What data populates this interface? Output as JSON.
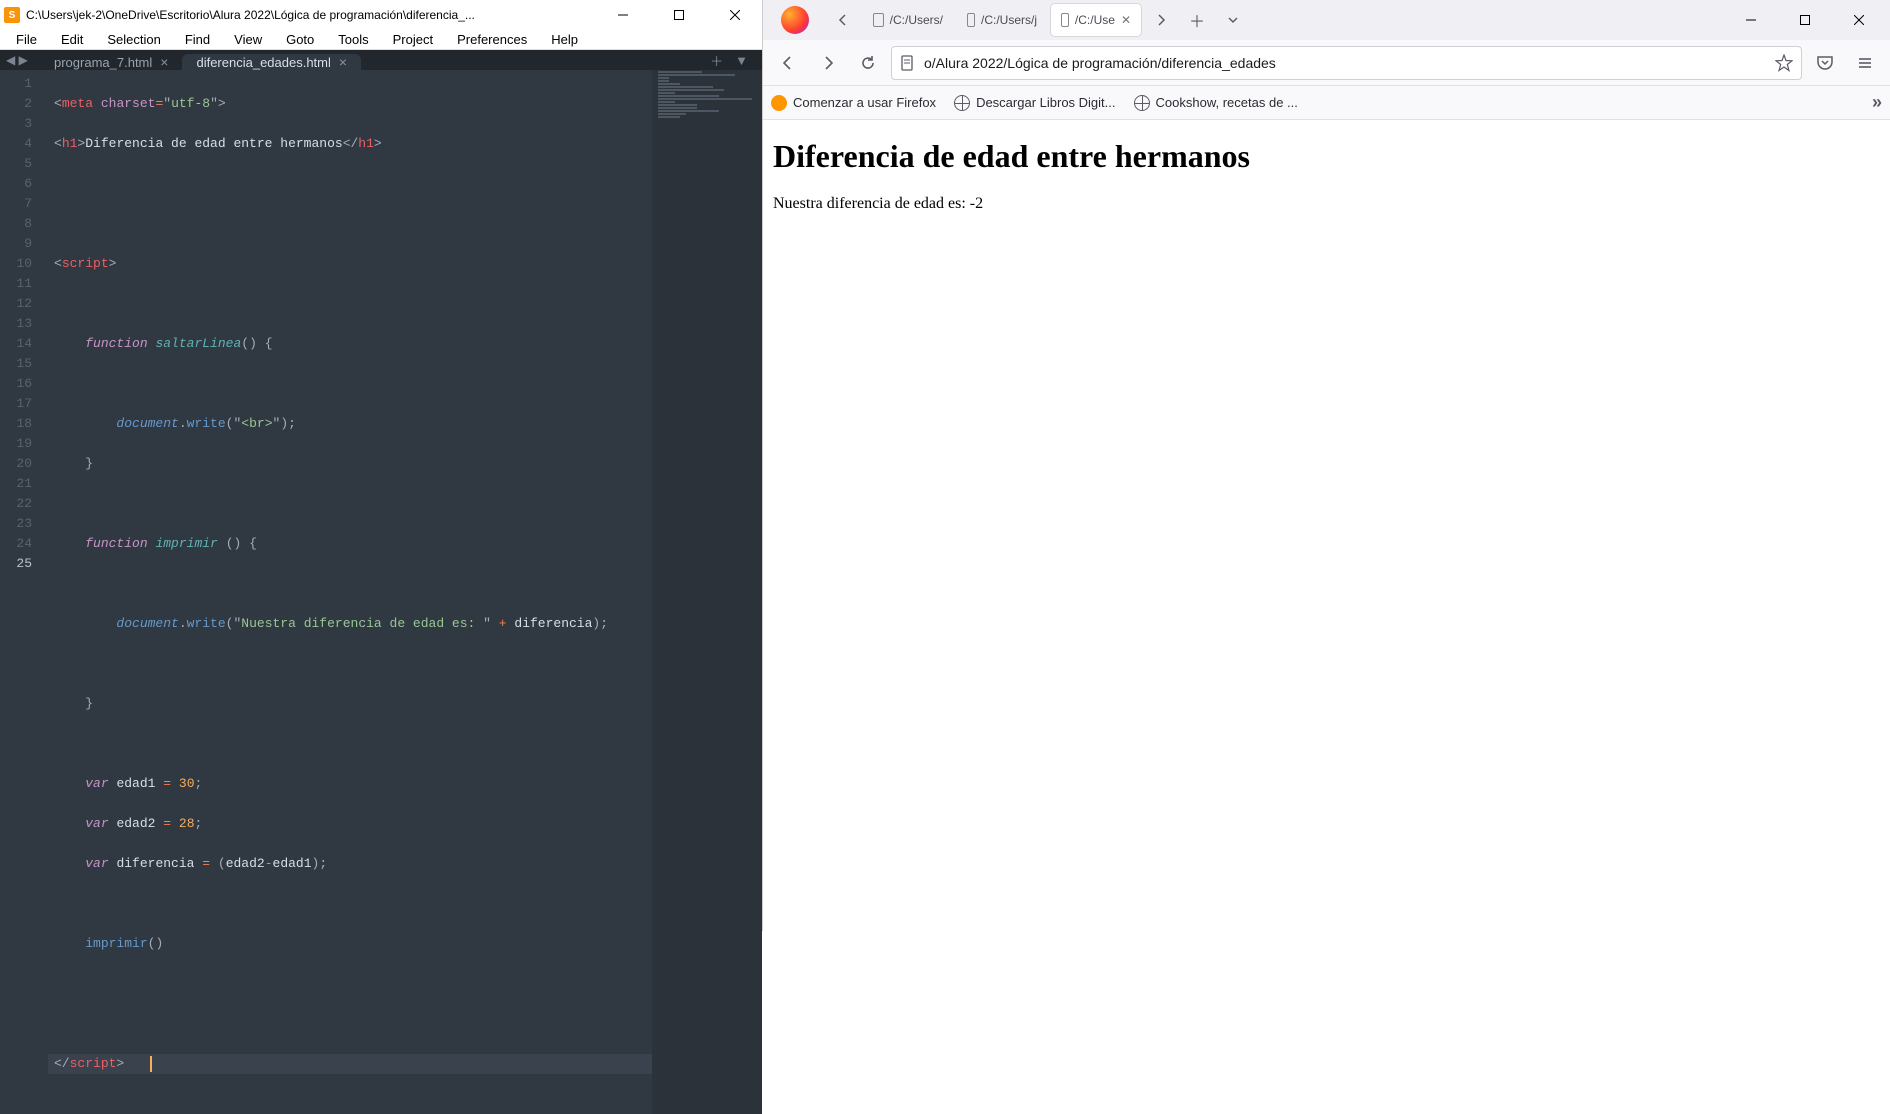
{
  "sublime": {
    "app_icon_letter": "S",
    "title": "C:\\Users\\jek-2\\OneDrive\\Escritorio\\Alura 2022\\Lógica de programación\\diferencia_...",
    "menu": [
      "File",
      "Edit",
      "Selection",
      "Find",
      "View",
      "Goto",
      "Tools",
      "Project",
      "Preferences",
      "Help"
    ],
    "tabs": [
      {
        "label": "programa_7.html",
        "active": false
      },
      {
        "label": "diferencia_edades.html",
        "active": true
      }
    ],
    "line_numbers": [
      "1",
      "2",
      "3",
      "4",
      "5",
      "6",
      "7",
      "8",
      "9",
      "10",
      "11",
      "12",
      "13",
      "14",
      "15",
      "16",
      "17",
      "18",
      "19",
      "20",
      "21",
      "22",
      "23",
      "24",
      "25"
    ],
    "current_line": 25,
    "code": {
      "l1": {
        "tag_open": "<",
        "tag": "meta",
        "sp": " ",
        "attr": "charset",
        "eq": "=",
        "q1": "\"",
        "val": "utf-8",
        "q2": "\"",
        "tag_close": ">"
      },
      "l2": {
        "tag_open": "<",
        "tag": "h1",
        "tag_gt": ">",
        "text": "Diferencia de edad entre hermanos",
        "tag_close_open": "</",
        "tag_close": "h1",
        "tag_close_gt": ">"
      },
      "l5": {
        "tag_open": "<",
        "tag": "script",
        "tag_gt": ">"
      },
      "l7": {
        "kw": "function",
        "sp": " ",
        "name": "saltarLinea",
        "paren": "()",
        "sp2": " ",
        "brace": "{"
      },
      "l9_indent": "        ",
      "l9": {
        "obj": "document",
        "dot": ".",
        "fn": "write",
        "paren_open": "(",
        "q": "\"",
        "str": "<br>",
        "q2": "\"",
        "paren_close": ")",
        "semi": ";"
      },
      "l10": {
        "brace": "}"
      },
      "l12": {
        "kw": "function",
        "sp": " ",
        "name": "imprimir",
        "sp2": " ",
        "paren": "()",
        "sp3": " ",
        "brace": "{"
      },
      "l14": {
        "obj": "document",
        "dot": ".",
        "fn": "write",
        "paren_open": "(",
        "q": "\"",
        "str": "Nuestra diferencia de edad es: ",
        "q2": "\"",
        "sp": " ",
        "plus": "+",
        "sp2": " ",
        "var": "diferencia",
        "paren_close": ")",
        "semi": ";"
      },
      "l16": {
        "brace": "}"
      },
      "l18": {
        "kw": "var",
        "sp": " ",
        "name": "edad1",
        "sp2": " ",
        "eq": "=",
        "sp3": " ",
        "num": "30",
        "semi": ";"
      },
      "l19": {
        "kw": "var",
        "sp": " ",
        "name": "edad2",
        "sp2": " ",
        "eq": "=",
        "sp3": " ",
        "num": "28",
        "semi": ";"
      },
      "l20": {
        "kw": "var",
        "sp": " ",
        "name": "diferencia",
        "sp2": " ",
        "eq": "=",
        "sp3": " ",
        "paren_open": "(",
        "a": "edad2",
        "minus": "-",
        "b": "edad1",
        "paren_close": ")",
        "semi": ";"
      },
      "l22": {
        "fn": "imprimir",
        "paren": "()"
      },
      "l25": {
        "tag_open": "</",
        "tag": "script",
        "tag_gt": ">"
      },
      "indent1": "    ",
      "indent2": "        "
    }
  },
  "firefox": {
    "tabs": [
      {
        "label": "/C:/Users/",
        "active": false
      },
      {
        "label": "/C:/Users/j",
        "active": false
      },
      {
        "label": "/C:/Use",
        "active": true
      }
    ],
    "nav": {
      "back": "←",
      "forward": "→",
      "reload": "⟳"
    },
    "url": "o/Alura 2022/Lógica de programación/diferencia_edades",
    "bookmarks": [
      {
        "icon": "firefox",
        "label": "Comenzar a usar Firefox"
      },
      {
        "icon": "globe",
        "label": "Descargar Libros Digit..."
      },
      {
        "icon": "globe",
        "label": "Cookshow, recetas de ..."
      }
    ],
    "page": {
      "h1": "Diferencia de edad entre hermanos",
      "body": "Nuestra diferencia de edad es: -2"
    }
  }
}
